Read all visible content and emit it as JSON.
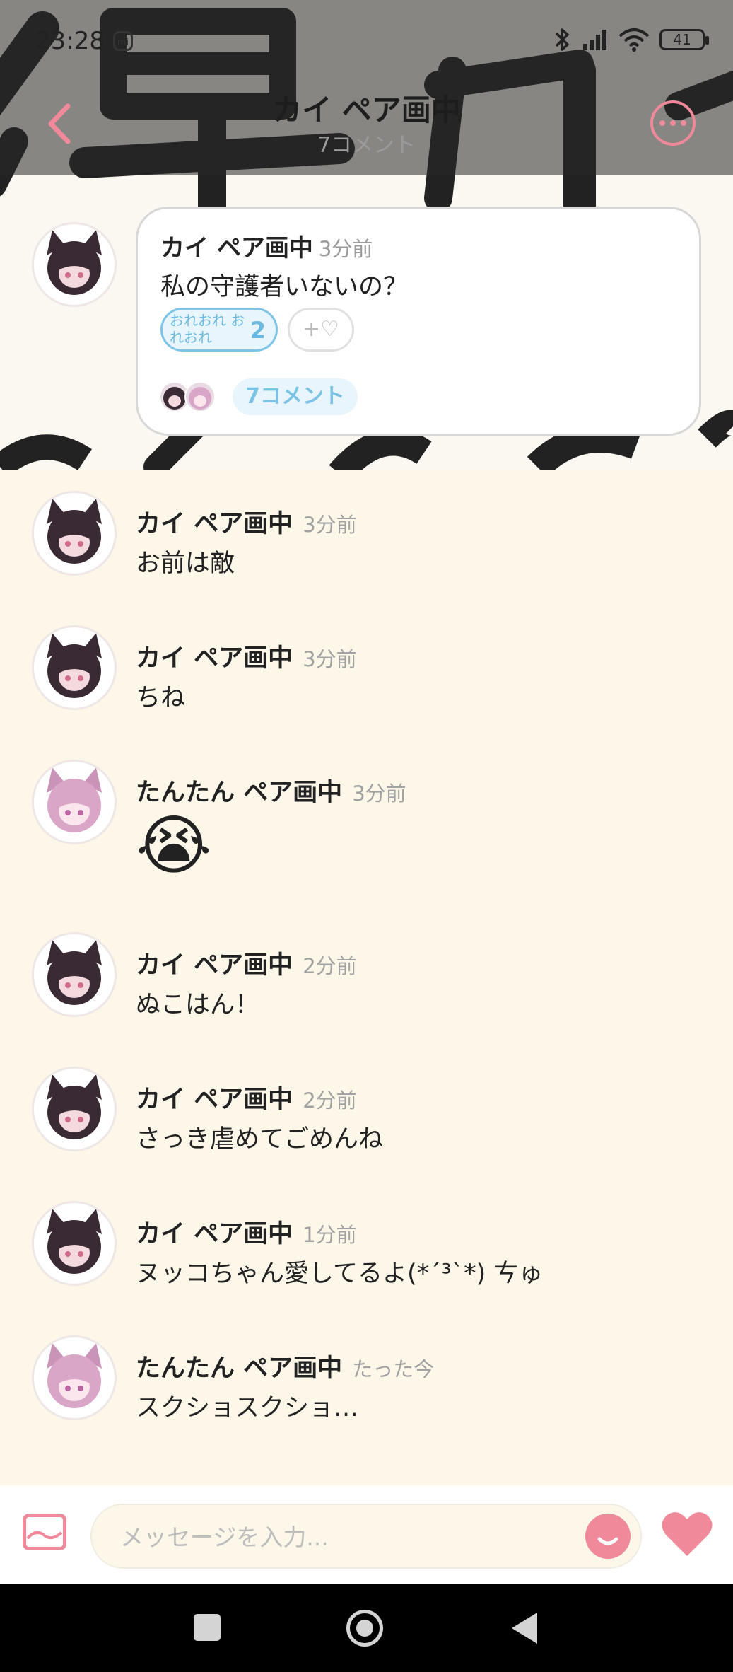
{
  "status_bar": {
    "time": "23:28",
    "mi_badge": "mi",
    "battery": "41"
  },
  "header": {
    "title": "カイ ペア画中",
    "subtitle": "7コメント",
    "back_icon": "chevron-left-icon",
    "more_icon": "more-dots-icon"
  },
  "post": {
    "author": "カイ ペア画中",
    "time": "3分前",
    "text": "私の守護者いないの？",
    "reaction": {
      "label": "おれおれ おれおれ",
      "count": "2"
    },
    "add_reaction": "+♡",
    "comments_label": "7コメント"
  },
  "messages": [
    {
      "author": "カイ ペア画中",
      "time": "3分前",
      "text": "お前は敵",
      "avatar": "dark"
    },
    {
      "author": "カイ ペア画中",
      "time": "3分前",
      "text": "ちね",
      "avatar": "dark"
    },
    {
      "author": "たんたん ペア画中",
      "time": "3分前",
      "text": "😭",
      "avatar": "pink"
    },
    {
      "author": "カイ ペア画中",
      "time": "2分前",
      "text": "ぬこはん！",
      "avatar": "dark"
    },
    {
      "author": "カイ ペア画中",
      "time": "2分前",
      "text": "さっき虐めてごめんね",
      "avatar": "dark"
    },
    {
      "author": "カイ ペア画中",
      "time": "1分前",
      "text": "ヌッコちゃん愛してるよ(*´³`*) ㄘゅ",
      "avatar": "dark"
    },
    {
      "author": "たんたん ペア画中",
      "time": "たった今",
      "text": "スクショスクショ…",
      "avatar": "pink"
    }
  ],
  "composer": {
    "placeholder": "メッセージを入力...",
    "image_icon": "image-icon",
    "emoji_icon": "smile-icon",
    "like_icon": "heart-icon"
  },
  "colors": {
    "accent": "#f08a9a",
    "reaction_blue": "#7ac3e4",
    "background": "#fdf7ea"
  }
}
